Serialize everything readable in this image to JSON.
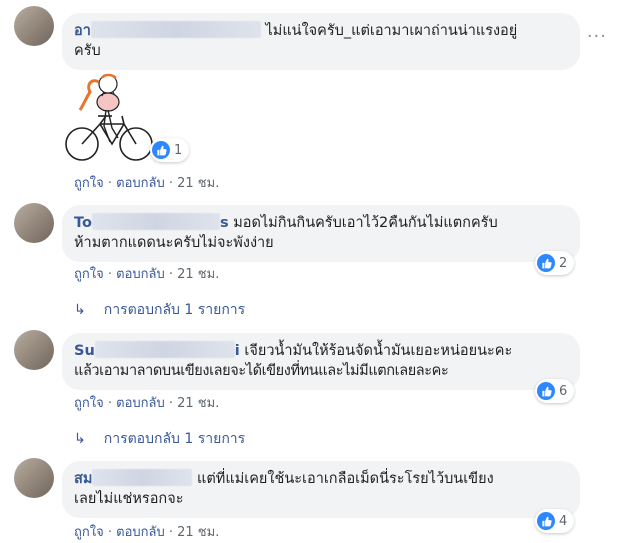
{
  "comments": [
    {
      "author_visible": "อา",
      "text_line1": "ไม่แน่ใจครับ_แต่เอามาเผาถ่านน่าแรงอยู่",
      "text_line2": "ครับ",
      "sticker_reactions": "1",
      "actions": {
        "like": "ถูกใจ",
        "reply": "ตอบกลับ",
        "time": "21 ชม."
      }
    },
    {
      "author_visible": "To",
      "author_tail": "s",
      "text_line1": "มอดไม่กินกินครับเอาไว้2คืนกันไม่แตกครับ",
      "text_line2": "ห้ามตากแดดนะครับไม่จะพังง่าย",
      "reactions": "2",
      "actions": {
        "like": "ถูกใจ",
        "reply": "ตอบกลับ",
        "time": "21 ชม."
      },
      "replies_label": "การตอบกลับ 1 รายการ"
    },
    {
      "author_visible": "Su",
      "author_tail": "i",
      "text_line1": "เจียวน้ำมันให้ร้อนจัดน้ำมันเยอะหน่อยนะคะ",
      "text_line2": "แล้วเอามาลาดบนเขียงเลยจะได้เขียงที่ทนและไม่มีแตกเลยละคะ",
      "reactions": "6",
      "actions": {
        "like": "ถูกใจ",
        "reply": "ตอบกลับ",
        "time": "21 ชม."
      },
      "replies_label": "การตอบกลับ 1 รายการ"
    },
    {
      "author_visible": "สม",
      "text_line1": "แต่ที่แม่เคยใช้นะเอาเกลือเม็ดนี่ระโรยไว้บนเขียง",
      "text_line2": "เลยไม่แช่หรอกจะ",
      "reactions": "4",
      "actions": {
        "like": "ถูกใจ",
        "reply": "ตอบกลับ",
        "time": "21 ชม."
      }
    }
  ],
  "icons": {
    "like": "thumbs-up-icon",
    "reply_arrow": "reply-arrow-icon",
    "more": "more-options-icon"
  },
  "colors": {
    "link": "#385898",
    "like_blue": "#2d88ff",
    "bubble": "#f2f3f5",
    "meta": "#606770"
  }
}
